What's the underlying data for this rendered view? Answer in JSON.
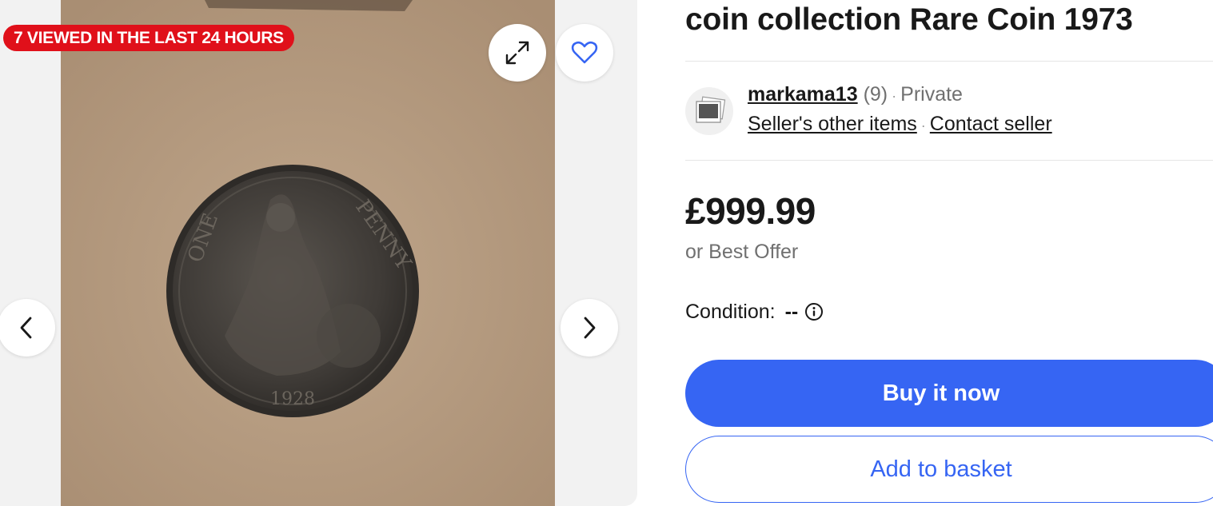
{
  "gallery": {
    "views_badge": "7 VIEWED IN THE LAST 24 HOURS",
    "coin_inscription_left": "ONE",
    "coin_inscription_right": "PENNY",
    "coin_year": "1928",
    "icons": {
      "expand": "expand-icon",
      "favorite": "heart-icon",
      "previous": "chevron-left-icon",
      "next": "chevron-right-icon"
    }
  },
  "listing": {
    "title": "coin collection Rare Coin 1973",
    "seller": {
      "name": "markama13",
      "feedback": "(9)",
      "type": "Private",
      "other_items_link": "Seller's other items",
      "contact_link": "Contact seller"
    },
    "price": "£999.99",
    "best_offer": "or Best Offer",
    "condition_label": "Condition:",
    "condition_value": "--",
    "buy_button": "Buy it now",
    "basket_button": "Add to basket"
  },
  "colors": {
    "accent_blue": "#3665f3",
    "badge_red": "#e0101a",
    "text_primary": "#191919",
    "text_muted": "#707070"
  }
}
